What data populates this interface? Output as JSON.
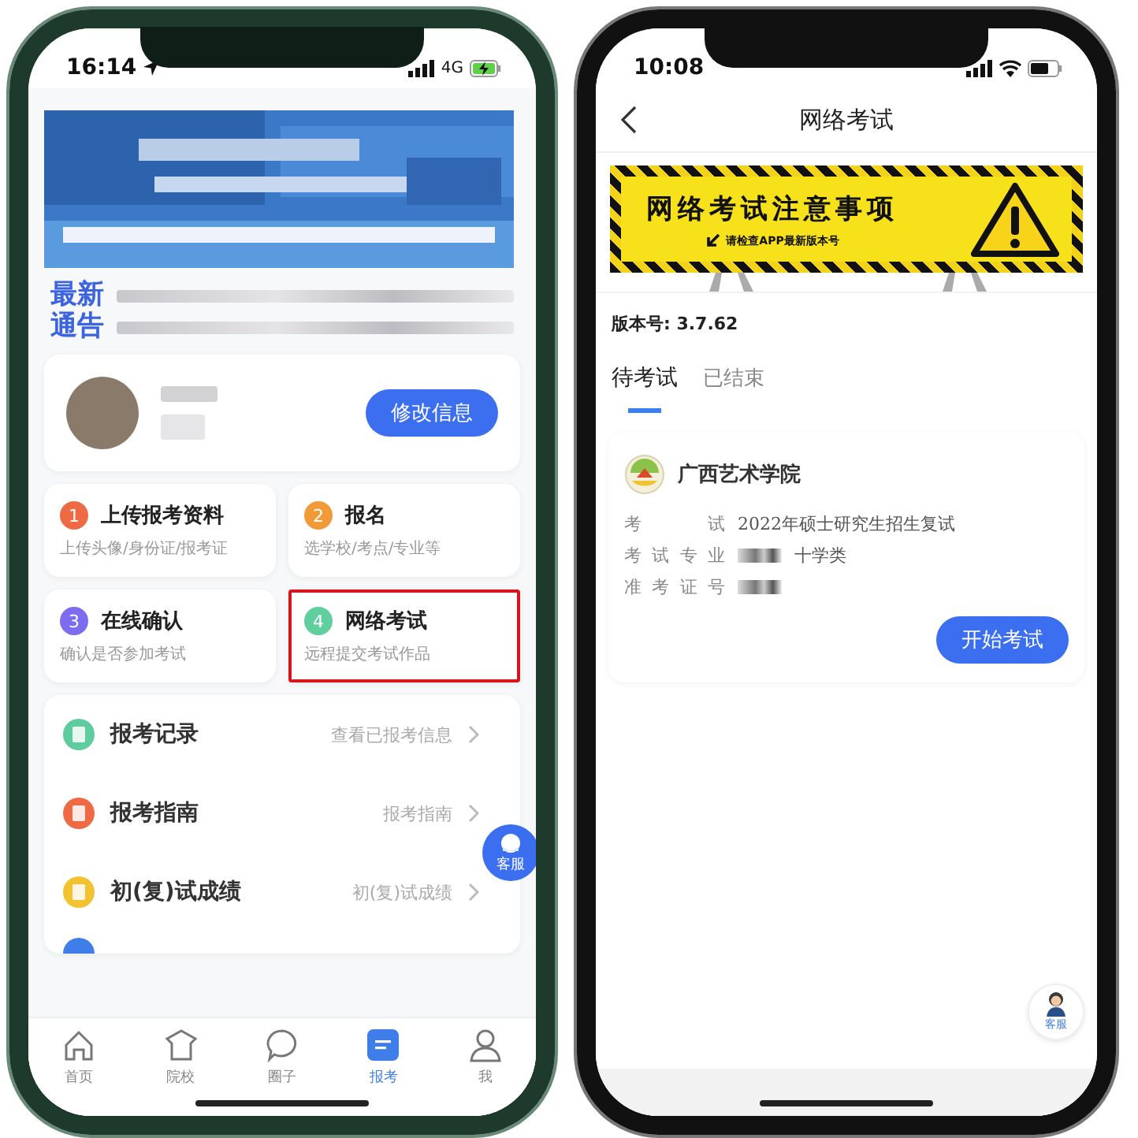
{
  "left_phone": {
    "status_bar": {
      "time": "16:14",
      "network": "4G"
    },
    "notice": {
      "label": "最新通告"
    },
    "profile": {
      "button": "修改信息"
    },
    "steps": [
      {
        "number": "1",
        "title": "上传报考资料",
        "subtitle": "上传头像/身份证/报考证",
        "color": "#ee6a45",
        "highlighted": false
      },
      {
        "number": "2",
        "title": "报名",
        "subtitle": "选学校/考点/专业等",
        "color": "#f19a38",
        "highlighted": false
      },
      {
        "number": "3",
        "title": "在线确认",
        "subtitle": "确认是否参加考试",
        "color": "#7b6cf0",
        "highlighted": false
      },
      {
        "number": "4",
        "title": "网络考试",
        "subtitle": "远程提交考试作品",
        "color": "#5fcf9e",
        "highlighted": true
      }
    ],
    "menu": [
      {
        "title": "报考记录",
        "detail": "查看已报考信息",
        "color": "#5fcca0"
      },
      {
        "title": "报考指南",
        "detail": "报考指南",
        "color": "#ee6a45"
      },
      {
        "title": "初(复)试成绩",
        "detail": "初(复)试成绩",
        "color": "#f2c230"
      }
    ],
    "help_button": "客服",
    "tab_bar": [
      {
        "label": "首页",
        "kind": "home",
        "selected": false
      },
      {
        "label": "院校",
        "kind": "school",
        "selected": false
      },
      {
        "label": "圈子",
        "kind": "chat",
        "selected": false
      },
      {
        "label": "报考",
        "kind": "form",
        "selected": true
      },
      {
        "label": "我",
        "kind": "user",
        "selected": false
      }
    ]
  },
  "right_phone": {
    "status_bar": {
      "time": "10:08"
    },
    "nav": {
      "title": "网络考试"
    },
    "banner": {
      "title": "网络考试注意事项",
      "subtitle": "请检查APP最新版本号"
    },
    "version": "版本号: 3.7.62",
    "tabs": [
      {
        "label": "待考试",
        "selected": true
      },
      {
        "label": "已结束",
        "selected": false
      }
    ],
    "exam": {
      "school": "广西艺术学院",
      "fields": [
        {
          "label": "考试",
          "value": "2022年硕士研究生招生复试"
        },
        {
          "label": "考试专业",
          "value": "十学类",
          "redacted": true
        },
        {
          "label": "准考证号",
          "redacted": true
        }
      ],
      "button": "开始考试"
    },
    "help_label": "客服"
  }
}
